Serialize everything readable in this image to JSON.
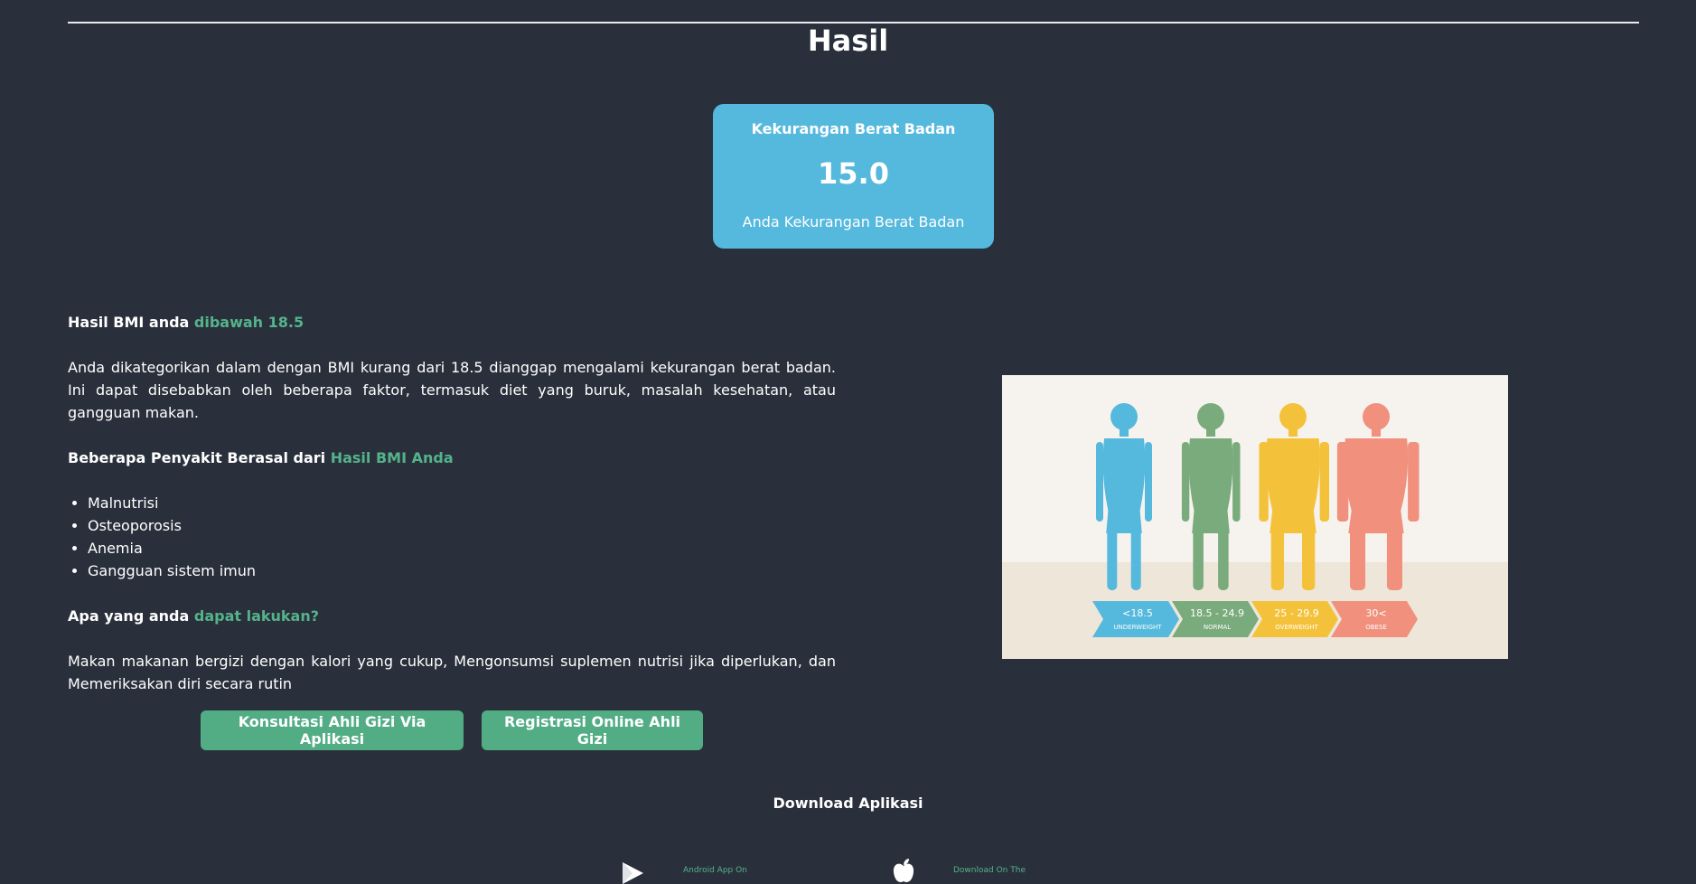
{
  "page": {
    "title": "Hasil"
  },
  "result_card": {
    "category": "Kekurangan Berat Badan",
    "value": "15.0",
    "description": "Anda Kekurangan Berat Badan"
  },
  "bmi_section": {
    "heading_prefix": "Hasil BMI anda",
    "heading_accent": "dibawah 18.5",
    "paragraph": "Anda dikategorikan dalam dengan BMI kurang dari 18.5 dianggap mengalami kekurangan berat badan. Ini dapat disebabkan oleh beberapa faktor, termasuk diet yang buruk, masalah kesehatan, atau gangguan makan."
  },
  "disease_section": {
    "heading_prefix": "Beberapa Penyakit Berasal dari",
    "heading_accent": "Hasil BMI Anda",
    "items": [
      "Malnutrisi",
      "Osteoporosis",
      "Anemia",
      "Gangguan sistem imun"
    ]
  },
  "action_section": {
    "heading_prefix": "Apa yang anda",
    "heading_accent": "dapat lakukan?",
    "paragraph": "Makan makanan bergizi dengan kalori yang cukup, Mengonsumsi suplemen nutrisi jika diperlukan, dan Memeriksakan diri secara rutin"
  },
  "buttons": {
    "consult": "Konsultasi Ahli Gizi Via Aplikasi",
    "register": "Registrasi Online Ahli Gizi"
  },
  "bmi_figure": {
    "categories": [
      {
        "range": "<18.5",
        "label": "UNDERWEIGHT",
        "color": "#55b8dd"
      },
      {
        "range": "18.5 - 24.9",
        "label": "NORMAL",
        "color": "#7aab7c"
      },
      {
        "range": "25 - 29.9",
        "label": "OVERWEIGHT",
        "color": "#f4c23a"
      },
      {
        "range": "30<",
        "label": "OBESE",
        "color": "#f0907d"
      }
    ]
  },
  "download": {
    "title": "Download Aplikasi",
    "android_label": "Android App On",
    "apple_label": "Download On The",
    "android_icon": "play-store-icon",
    "apple_icon": "apple-icon"
  },
  "colors": {
    "background": "#29303b",
    "card": "#55b8dd",
    "accent": "#55b38a",
    "button": "#52ad85"
  }
}
